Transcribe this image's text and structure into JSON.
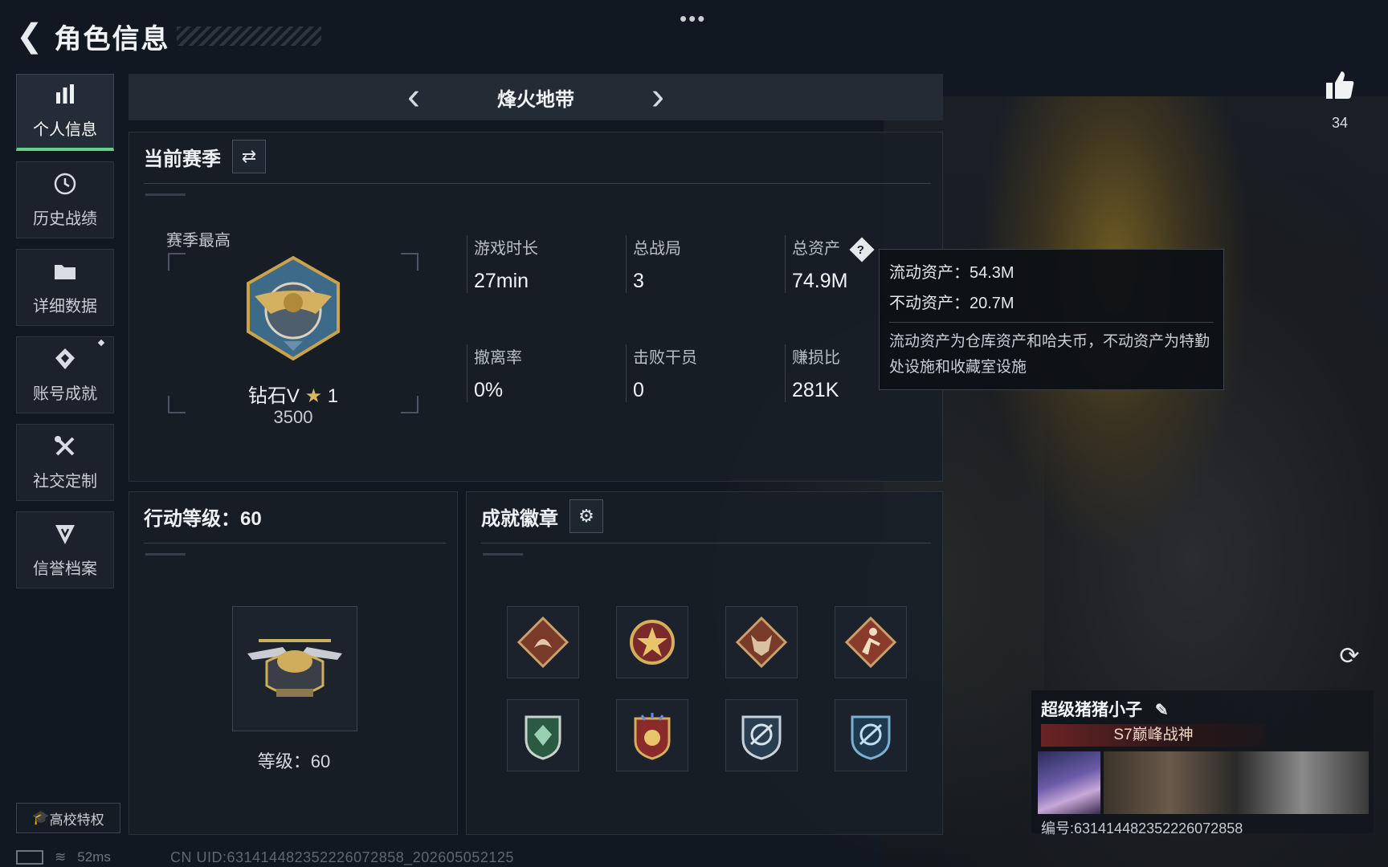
{
  "header": {
    "title": "角色信息",
    "more": "•••"
  },
  "sidebar": {
    "items": [
      {
        "label": "个人信息",
        "icon": "bar-chart-icon",
        "active": true
      },
      {
        "label": "历史战绩",
        "icon": "history-icon"
      },
      {
        "label": "详细数据",
        "icon": "folder-icon"
      },
      {
        "label": "账号成就",
        "icon": "achievement-icon"
      },
      {
        "label": "社交定制",
        "icon": "tools-icon"
      },
      {
        "label": "信誉档案",
        "icon": "credit-shield-icon"
      }
    ],
    "campus_button": "高校特权"
  },
  "mode_bar": {
    "title": "烽火地带"
  },
  "season": {
    "title": "当前赛季",
    "best_label": "赛季最高",
    "rank_name": "钻石V",
    "rank_stars": "1",
    "rank_score": "3500",
    "stats": [
      {
        "label": "游戏时长",
        "value": "27min"
      },
      {
        "label": "总战局",
        "value": "3"
      },
      {
        "label": "总资产",
        "value": "74.9M"
      },
      {
        "label": "撤离率",
        "value": "0%"
      },
      {
        "label": "击败干员",
        "value": "0"
      },
      {
        "label": "赚损比",
        "value": "281K"
      }
    ]
  },
  "assets_tooltip": {
    "liquid": "流动资产：54.3M",
    "fixed": "不动资产：20.7M",
    "description": "流动资产为仓库资产和哈夫币，不动资产为特勤处设施和收藏室设施"
  },
  "action_level": {
    "title": "行动等级：60",
    "level_text": "等级：60"
  },
  "badges": {
    "title": "成就徽章",
    "items": [
      {
        "icon": "dragon-badge-icon"
      },
      {
        "icon": "star-medal-badge-icon"
      },
      {
        "icon": "wolf-badge-icon"
      },
      {
        "icon": "runner-badge-icon"
      },
      {
        "icon": "green-shield-badge-icon"
      },
      {
        "icon": "rocket-stars-badge-icon"
      },
      {
        "icon": "target-shield-badge-icon"
      },
      {
        "icon": "target-shield-blue-badge-icon"
      }
    ]
  },
  "likes": {
    "count": "34"
  },
  "profile": {
    "name": "超级猪猪小子",
    "title": "S7巅峰战神",
    "id_text": "编号:631414482352226072858"
  },
  "footer": {
    "ping": "52ms",
    "uid": "CN UID:631414482352226072858_202605052125"
  },
  "colors": {
    "accent_green": "#5ed08a",
    "gold": "#d8b75e"
  }
}
